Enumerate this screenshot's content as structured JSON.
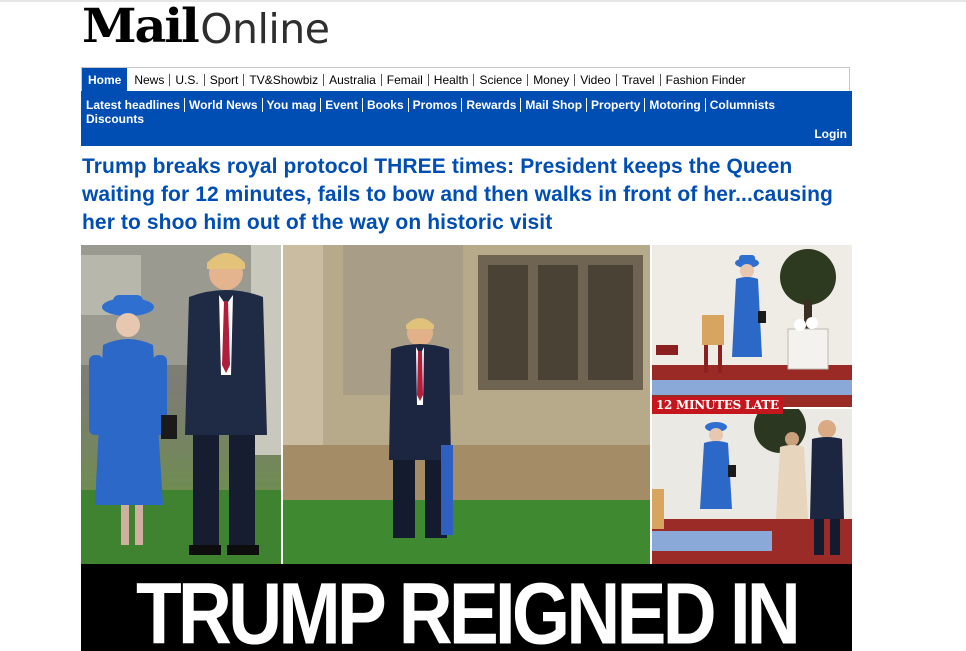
{
  "logo": {
    "mail": "Mail",
    "online": "Online"
  },
  "nav_primary": {
    "items": [
      "Home",
      "News",
      "U.S.",
      "Sport",
      "TV&Showbiz",
      "Australia",
      "Femail",
      "Health",
      "Science",
      "Money",
      "Video",
      "Travel",
      "Fashion Finder"
    ],
    "active": "Home"
  },
  "nav_secondary": {
    "row1": [
      "Latest headlines",
      "World News",
      "You mag",
      "Event",
      "Books",
      "Promos",
      "Rewards",
      "Mail Shop",
      "Property",
      "Motoring",
      "Columnists"
    ],
    "row2": [
      "Discounts"
    ],
    "login_label": "Login"
  },
  "article": {
    "headline": "Trump breaks royal protocol THREE times: President keeps the Queen waiting for 12 minutes, fails to bow and then walks in front of her...causing her to shoo him out of the way on historic visit",
    "badge": "12 MINUTES LATE",
    "banner": "TRUMP REIGNED IN"
  },
  "colors": {
    "brand_blue": "#004db3",
    "badge_red": "#c4161c",
    "banner_black": "#000000"
  }
}
